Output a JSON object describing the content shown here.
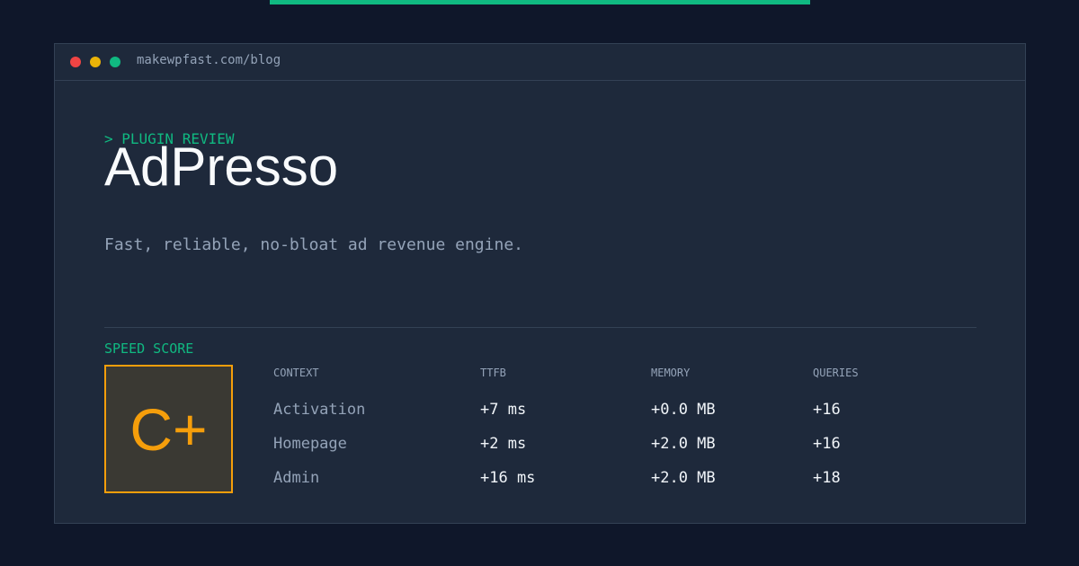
{
  "window": {
    "url": "makewpfast.com/blog"
  },
  "header": {
    "eyebrow": "> PLUGIN REVIEW",
    "title": "AdPresso",
    "tagline": "Fast, reliable, no-bloat ad revenue engine."
  },
  "score": {
    "label": "SPEED SCORE",
    "grade": "C+"
  },
  "table": {
    "columns": [
      "CONTEXT",
      "TTFB",
      "MEMORY",
      "QUERIES"
    ],
    "rows": [
      [
        "Activation",
        "+7 ms",
        "+0.0 MB",
        "+16"
      ],
      [
        "Homepage",
        "+2 ms",
        "+2.0 MB",
        "+16"
      ],
      [
        "Admin",
        "+16 ms",
        "+2.0 MB",
        "+18"
      ]
    ]
  },
  "colors": {
    "accent": "#10b981",
    "grade": "#f59e0b",
    "background": "#0f172a",
    "panel": "#1e293b"
  }
}
